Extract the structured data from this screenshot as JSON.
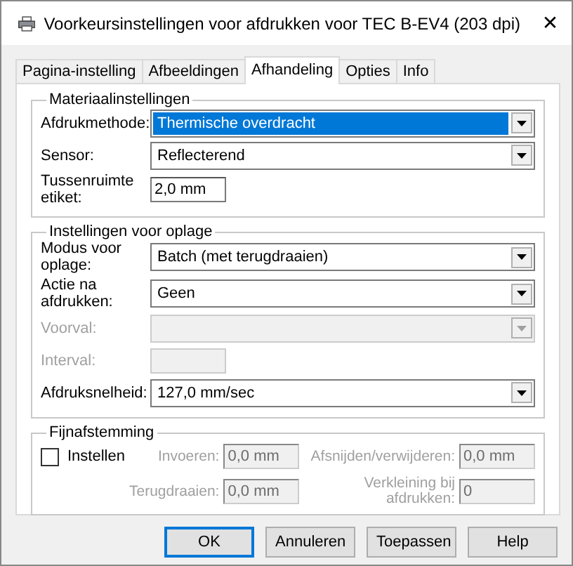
{
  "window": {
    "title": "Voorkeursinstellingen voor afdrukken voor TEC B-EV4 (203 dpi)",
    "close": "✕"
  },
  "tabs": [
    {
      "label": "Pagina-instelling",
      "selected": false
    },
    {
      "label": "Afbeeldingen",
      "selected": false
    },
    {
      "label": "Afhandeling",
      "selected": true
    },
    {
      "label": "Opties",
      "selected": false
    },
    {
      "label": "Info",
      "selected": false
    }
  ],
  "groups": [
    {
      "title": "Materiaalinstellingen",
      "rows": [
        {
          "kind": "dropdown",
          "label": "Afdrukmethode:",
          "value": "Thermische overdracht",
          "highlighted": true,
          "disabled": false
        },
        {
          "kind": "dropdown",
          "label": "Sensor:",
          "value": "Reflecterend",
          "highlighted": false,
          "disabled": false
        },
        {
          "kind": "text",
          "label": "Tussenruimte etiket:",
          "value": "2,0 mm",
          "disabled": false
        }
      ]
    },
    {
      "title": "Instellingen voor oplage",
      "rows": [
        {
          "kind": "dropdown",
          "label": "Modus voor oplage:",
          "value": "Batch (met terugdraaien)",
          "highlighted": false,
          "disabled": false
        },
        {
          "kind": "dropdown",
          "label": "Actie na afdrukken:",
          "value": "Geen",
          "highlighted": false,
          "disabled": false
        },
        {
          "kind": "dropdown",
          "label": "Voorval:",
          "highlighted": false,
          "disabled": true
        },
        {
          "kind": "text",
          "label": "Interval:",
          "disabled": true
        },
        {
          "kind": "dropdown",
          "label": "Afdruksnelheid:",
          "value": "127,0 mm/sec",
          "highlighted": false,
          "disabled": false
        }
      ]
    }
  ],
  "fine_tuning": {
    "title": "Fijnafstemming",
    "checkbox": {
      "label": "Instellen",
      "checked": false
    },
    "fields": [
      {
        "label": "Invoeren:",
        "value": "0,0 mm",
        "disabled": true
      },
      {
        "label": "Afsnijden/verwijderen:",
        "value": "0,0 mm",
        "disabled": true
      },
      {
        "label": "Terugdraaien:",
        "value": "0,0 mm",
        "disabled": true
      },
      {
        "label": "Verkleining bij afdrukken:",
        "value": "0",
        "disabled": true
      }
    ]
  },
  "buttons": [
    {
      "label": "OK",
      "default": true
    },
    {
      "label": "Annuleren",
      "default": false
    },
    {
      "label": "Toepassen",
      "default": false
    },
    {
      "label": "Help",
      "default": false
    }
  ]
}
